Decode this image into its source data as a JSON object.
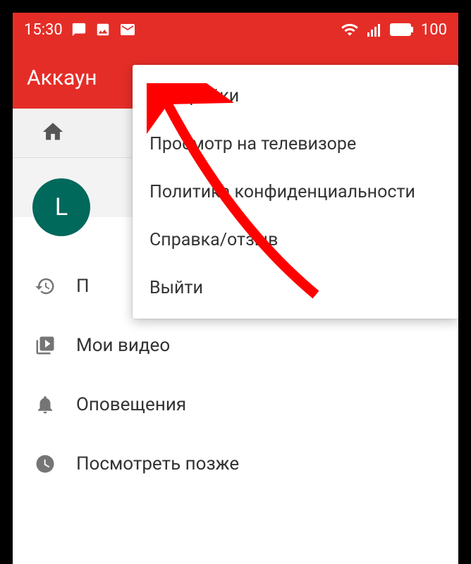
{
  "status_bar": {
    "time": "15:30",
    "battery": "100"
  },
  "app_bar": {
    "title": "Аккаун"
  },
  "avatar": {
    "letter": "L"
  },
  "menu": {
    "items": [
      {
        "label": "Настройки"
      },
      {
        "label": "Просмотр на телевизоре"
      },
      {
        "label": "Политика конфиденциальности"
      },
      {
        "label": "Справка/отзыв"
      },
      {
        "label": "Выйти"
      }
    ]
  },
  "list": {
    "items": [
      {
        "label": "П",
        "icon": "history-icon"
      },
      {
        "label": "Мои видео",
        "icon": "play-box-icon"
      },
      {
        "label": "Оповещения",
        "icon": "bell-icon"
      },
      {
        "label": "Посмотреть позже",
        "icon": "clock-icon"
      }
    ]
  },
  "colors": {
    "brand_red": "#e52d27",
    "avatar_bg": "#00695c",
    "arrow_red": "#ff0000"
  }
}
